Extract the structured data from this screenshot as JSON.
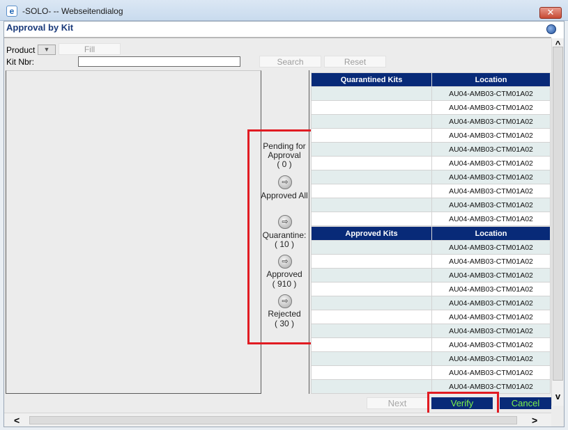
{
  "window": {
    "title": "-SOLO- -- Webseitendialog",
    "close_label": "✕",
    "app_icon": "e"
  },
  "page": {
    "title": "Approval by Kit"
  },
  "filter": {
    "product_label": "Product",
    "fill_label": "Fill",
    "kit_nbr_label": "Kit Nbr:",
    "kit_nbr_value": "",
    "search_label": "Search",
    "reset_label": "Reset"
  },
  "middle": {
    "pending": {
      "label": "Pending for Approval",
      "count": "( 0 )"
    },
    "approved_all": {
      "label": "Approved All"
    },
    "quarantine": {
      "label": "Quarantine:",
      "count": "( 10 )"
    },
    "approved": {
      "label": "Approved",
      "count": "( 910 )"
    },
    "rejected": {
      "label": "Rejected",
      "count": "( 30 )"
    },
    "arrow_glyph": "⇨"
  },
  "quarantined_table": {
    "headers": [
      "Quarantined Kits",
      "Location"
    ],
    "rows": [
      [
        "",
        "AU04-AMB03-CTM01A02"
      ],
      [
        "",
        "AU04-AMB03-CTM01A02"
      ],
      [
        "",
        "AU04-AMB03-CTM01A02"
      ],
      [
        "",
        "AU04-AMB03-CTM01A02"
      ],
      [
        "",
        "AU04-AMB03-CTM01A02"
      ],
      [
        "",
        "AU04-AMB03-CTM01A02"
      ],
      [
        "",
        "AU04-AMB03-CTM01A02"
      ],
      [
        "",
        "AU04-AMB03-CTM01A02"
      ],
      [
        "",
        "AU04-AMB03-CTM01A02"
      ],
      [
        "",
        "AU04-AMB03-CTM01A02"
      ]
    ]
  },
  "approved_table": {
    "headers": [
      "Approved Kits",
      "Location"
    ],
    "rows": [
      [
        "",
        "AU04-AMB03-CTM01A02"
      ],
      [
        "",
        "AU04-AMB03-CTM01A02"
      ],
      [
        "",
        "AU04-AMB03-CTM01A02"
      ],
      [
        "",
        "AU04-AMB03-CTM01A02"
      ],
      [
        "",
        "AU04-AMB03-CTM01A02"
      ],
      [
        "",
        "AU04-AMB03-CTM01A02"
      ],
      [
        "",
        "AU04-AMB03-CTM01A02"
      ],
      [
        "",
        "AU04-AMB03-CTM01A02"
      ],
      [
        "",
        "AU04-AMB03-CTM01A02"
      ],
      [
        "",
        "AU04-AMB03-CTM01A02"
      ],
      [
        "",
        "AU04-AMB03-CTM01A02"
      ]
    ]
  },
  "buttons": {
    "next_label": "Next",
    "verify_label": "Verify",
    "cancel_label": "Cancel"
  },
  "scroll": {
    "up": "^",
    "down": "v",
    "left": "<",
    "right": ">"
  },
  "colors": {
    "header_blue": "#082a78",
    "highlight_red": "#e11b22",
    "button_text_green": "#7cf24a"
  }
}
